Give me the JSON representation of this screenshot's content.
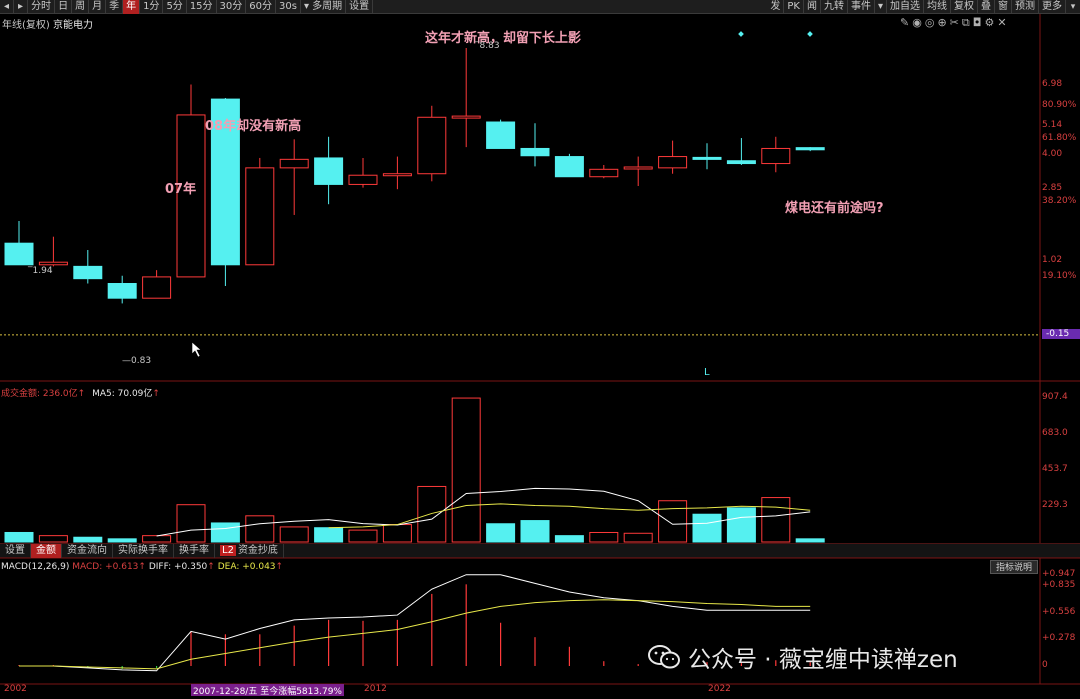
{
  "toolbar": {
    "left_items": [
      "分时",
      "日",
      "周",
      "月",
      "季",
      "年",
      "1分",
      "5分",
      "15分",
      "30分",
      "60分",
      "30s",
      "多周期",
      "设置"
    ],
    "active": "年",
    "right_items": [
      "发",
      "PK",
      "闻",
      "九转",
      "事件",
      "加自选",
      "均线",
      "复权",
      "叠",
      "窗",
      "预测",
      "更多"
    ]
  },
  "stock": {
    "period_label": "年线(复权)",
    "name": "京能电力"
  },
  "price_axis": {
    "labels": [
      {
        "text": "6.98",
        "y": 6.98
      },
      {
        "text": "80.90%",
        "y": 6.0
      },
      {
        "text": "5.14",
        "y": 5.14
      },
      {
        "text": "61.80%",
        "y": 4.6
      },
      {
        "text": "4.00",
        "y": 4.0
      },
      {
        "text": "2.85",
        "y": 2.85
      },
      {
        "text": "38.20%",
        "y": 2.45
      },
      {
        "text": "1.02",
        "y": 1.02
      },
      {
        "text": "19.10%",
        "y": 0.73
      },
      {
        "text": "-0.15",
        "y": -0.15
      }
    ]
  },
  "annotations": {
    "a1": "这年才新高，却留下长上影",
    "a2": "08年却没有新高",
    "a3": "07年",
    "a4": "煤电还有前途吗?"
  },
  "price_marks": {
    "high": "8.83",
    "low": "0.83",
    "first_high": "1.94"
  },
  "volume_pane": {
    "title": "成交金额: 236.0亿",
    "ma5": "MA5: 70.09亿",
    "axis": [
      "907.4",
      "683.0",
      "453.7",
      "229.3"
    ]
  },
  "tabs": [
    "设置",
    "金额",
    "资金流向",
    "实际换手率",
    "换手率",
    "资金抄底"
  ],
  "active_tab": "金额",
  "tab_badge": "L2",
  "macd": {
    "title": "MACD(12,26,9)",
    "macd_val": "MACD: +0.613",
    "diff_val": "DIFF: +0.350",
    "dea_val": "DEA: +0.043",
    "axis": [
      "+0.947",
      "+0.835",
      "+0.556",
      "+0.278",
      "0"
    ],
    "help": "指标说明"
  },
  "dates": {
    "d1": "2002",
    "d2": "2012",
    "d3": "2022",
    "highlight": "2007-12-28/五 至今涨幅5813.79%"
  },
  "cursor_marker": "L",
  "watermark": "公众号 · 薇宝缠中读禅zen",
  "colors": {
    "up": "#ff3a3a",
    "down": "#55f0f0",
    "ma5": "#ffffff",
    "ma10": "#e8e84a",
    "frame": "#7a1414"
  },
  "chart_data": {
    "type": "candlestick",
    "candles": [
      {
        "o": 1.4,
        "c": 0.95,
        "h": 1.94,
        "l": 0.95
      },
      {
        "o": 0.95,
        "c": 1.0,
        "h": 1.55,
        "l": 0.92
      },
      {
        "o": 0.92,
        "c": 0.7,
        "h": 1.25,
        "l": 0.62
      },
      {
        "o": 0.62,
        "c": 0.4,
        "h": 0.75,
        "l": 0.33
      },
      {
        "o": 0.4,
        "c": 0.73,
        "h": 0.85,
        "l": 0.4
      },
      {
        "o": 0.73,
        "c": 5.6,
        "h": 6.98,
        "l": 0.73
      },
      {
        "o": 6.3,
        "c": 0.95,
        "h": 6.35,
        "l": 0.58
      },
      {
        "o": 0.95,
        "c": 3.55,
        "h": 3.9,
        "l": 0.95
      },
      {
        "o": 3.55,
        "c": 3.85,
        "h": 4.6,
        "l": 2.1
      },
      {
        "o": 3.9,
        "c": 3.0,
        "h": 4.7,
        "l": 2.4
      },
      {
        "o": 3.0,
        "c": 3.3,
        "h": 3.9,
        "l": 2.9
      },
      {
        "o": 3.3,
        "c": 3.35,
        "h": 3.95,
        "l": 2.85
      },
      {
        "o": 3.35,
        "c": 5.5,
        "h": 6.0,
        "l": 3.1
      },
      {
        "o": 5.5,
        "c": 5.55,
        "h": 8.83,
        "l": 4.3
      },
      {
        "o": 5.3,
        "c": 4.25,
        "h": 5.4,
        "l": 4.25
      },
      {
        "o": 4.25,
        "c": 3.98,
        "h": 5.25,
        "l": 3.6
      },
      {
        "o": 3.95,
        "c": 3.25,
        "h": 4.05,
        "l": 3.25
      },
      {
        "o": 3.25,
        "c": 3.5,
        "h": 3.65,
        "l": 3.2
      },
      {
        "o": 3.55,
        "c": 3.58,
        "h": 3.95,
        "l": 2.95
      },
      {
        "o": 3.55,
        "c": 3.95,
        "h": 4.55,
        "l": 3.35
      },
      {
        "o": 3.92,
        "c": 3.85,
        "h": 4.45,
        "l": 3.5
      },
      {
        "o": 3.8,
        "c": 3.7,
        "h": 4.65,
        "l": 3.65
      },
      {
        "o": 3.7,
        "c": 4.25,
        "h": 4.7,
        "l": 3.4
      },
      {
        "o": 4.28,
        "c": 4.2,
        "h": 4.3,
        "l": 4.15
      }
    ],
    "volume": [
      60,
      40,
      30,
      20,
      40,
      235,
      120,
      165,
      95,
      90,
      75,
      110,
      350,
      907,
      115,
      135,
      40,
      60,
      55,
      260,
      175,
      215,
      280,
      20
    ],
    "macd_hist": [
      0.01,
      0.01,
      -0.01,
      -0.03,
      -0.02,
      0.36,
      0.33,
      0.33,
      0.42,
      0.48,
      0.47,
      0.48,
      0.75,
      0.85,
      0.45,
      0.3,
      0.2,
      0.05,
      0.02,
      -0.01,
      0.04,
      0.03,
      0.06,
      0.04
    ],
    "diff": [
      0.0,
      0.0,
      -0.02,
      -0.04,
      -0.05,
      0.36,
      0.28,
      0.39,
      0.48,
      0.5,
      0.51,
      0.53,
      0.8,
      0.95,
      0.95,
      0.86,
      0.77,
      0.71,
      0.68,
      0.62,
      0.58,
      0.58,
      0.58,
      0.58
    ],
    "dea": [
      0.0,
      0.0,
      -0.01,
      -0.02,
      -0.03,
      0.07,
      0.13,
      0.19,
      0.25,
      0.3,
      0.34,
      0.38,
      0.46,
      0.55,
      0.62,
      0.66,
      0.68,
      0.69,
      0.68,
      0.67,
      0.65,
      0.64,
      0.62,
      0.62
    ],
    "ma_vol_white": [
      null,
      null,
      null,
      null,
      38,
      75,
      85,
      115,
      131,
      141,
      116,
      107,
      144,
      306,
      318,
      338,
      334,
      320,
      260,
      112,
      118,
      155,
      165,
      190
    ],
    "ma_vol_yellow": [
      null,
      null,
      null,
      null,
      null,
      null,
      null,
      null,
      null,
      90,
      95,
      110,
      180,
      230,
      240,
      230,
      225,
      210,
      200,
      210,
      215,
      225,
      220,
      200
    ]
  }
}
